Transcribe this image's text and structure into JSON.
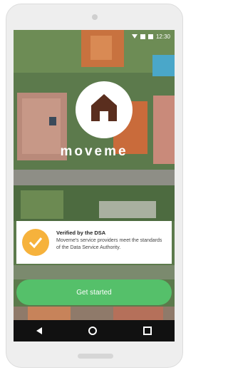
{
  "status_bar": {
    "time": "12:30"
  },
  "brand": {
    "name": "moveme"
  },
  "verification": {
    "title": "Verified by the DSA",
    "description": "Moveme's service providers meet the standards of the Data Service Authority."
  },
  "cta": {
    "label": "Get started"
  },
  "nav": {
    "icons": [
      "back-icon",
      "home-icon",
      "recents-icon"
    ]
  },
  "colors": {
    "accent": "#55c06a",
    "badge": "#f6b23c",
    "logo_house": "#5a2e1e"
  }
}
